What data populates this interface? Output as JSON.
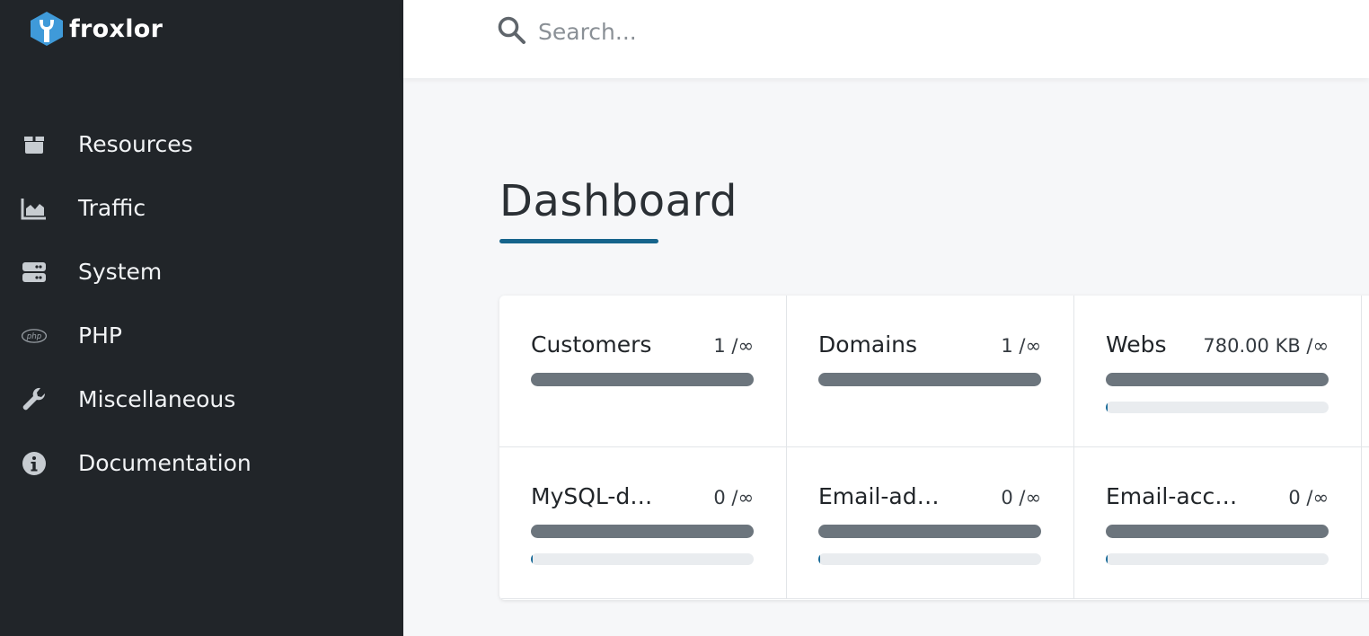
{
  "brand": {
    "name": "froxlor"
  },
  "search": {
    "placeholder": "Search..."
  },
  "sidebar": {
    "items": [
      {
        "label": "Resources",
        "icon": "box-icon"
      },
      {
        "label": "Traffic",
        "icon": "area-chart-icon"
      },
      {
        "label": "System",
        "icon": "server-icon"
      },
      {
        "label": "PHP",
        "icon": "php-icon"
      },
      {
        "label": "Miscellaneous",
        "icon": "wrench-icon"
      },
      {
        "label": "Documentation",
        "icon": "info-circle-icon"
      }
    ]
  },
  "main": {
    "title": "Dashboard",
    "cards": [
      {
        "label": "Customers",
        "value": "1 /∞",
        "sub_bar": false,
        "usage": null
      },
      {
        "label": "Domains",
        "value": "1 /∞",
        "sub_bar": false,
        "usage": null
      },
      {
        "label": "Webs",
        "value": "780.00 KB /∞",
        "sub_bar": true,
        "usage": 0.01
      },
      {
        "label": "MySQL-d…",
        "value": "0 /∞",
        "sub_bar": true,
        "usage": 0.01
      },
      {
        "label": "Email-ad…",
        "value": "0 /∞",
        "sub_bar": true,
        "usage": 0.01
      },
      {
        "label": "Email-acc…",
        "value": "0 /∞",
        "sub_bar": true,
        "usage": 0.01
      }
    ]
  },
  "colors": {
    "sidebar_bg": "#212529",
    "accent": "#16648c",
    "bar_main": "#6c757d",
    "bar_track": "#e9ecef"
  }
}
